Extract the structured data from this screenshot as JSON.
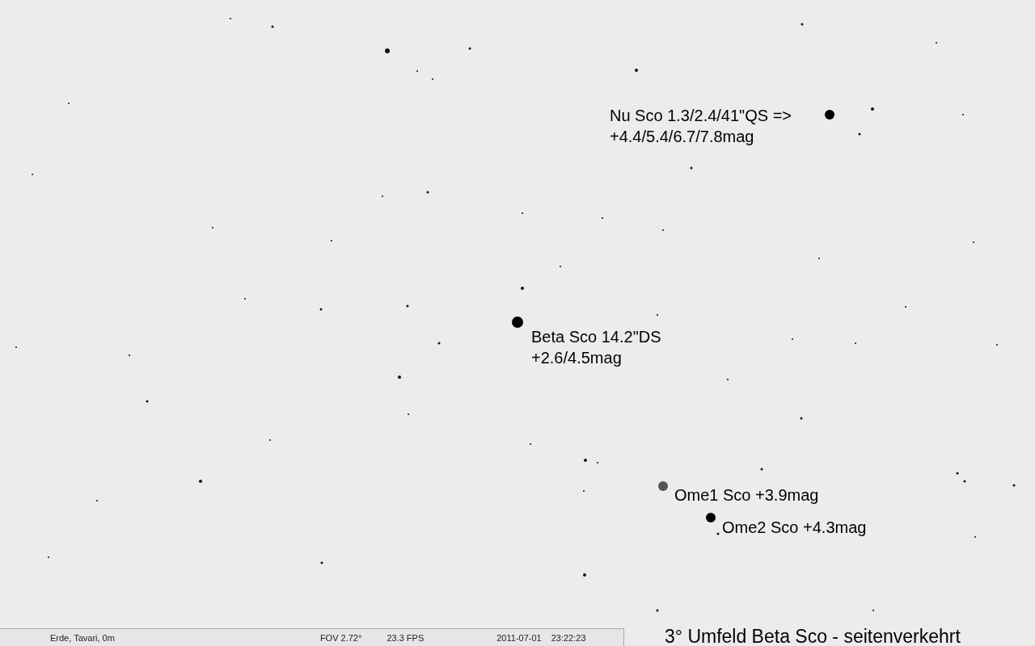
{
  "sky_chart": {
    "labels": [
      {
        "lines": [
          "Nu Sco 1.3/2.4/41\"QS =>",
          "+4.4/5.4/6.7/7.8mag"
        ]
      },
      {
        "lines": [
          "Beta Sco 14.2\"DS",
          "+2.6/4.5mag"
        ]
      },
      {
        "lines": [
          "Ome1 Sco +3.9mag"
        ]
      },
      {
        "lines": [
          "Ome2 Sco +4.3mag"
        ]
      }
    ]
  },
  "status_bar": {
    "location": "Erde, Tavari, 0m",
    "fov": "FOV 2.72°",
    "fps": "23.3 FPS",
    "date": "2011-07-01",
    "time": "23:22:23"
  },
  "caption": "3° Umfeld Beta Sco - seitenverkehrt"
}
